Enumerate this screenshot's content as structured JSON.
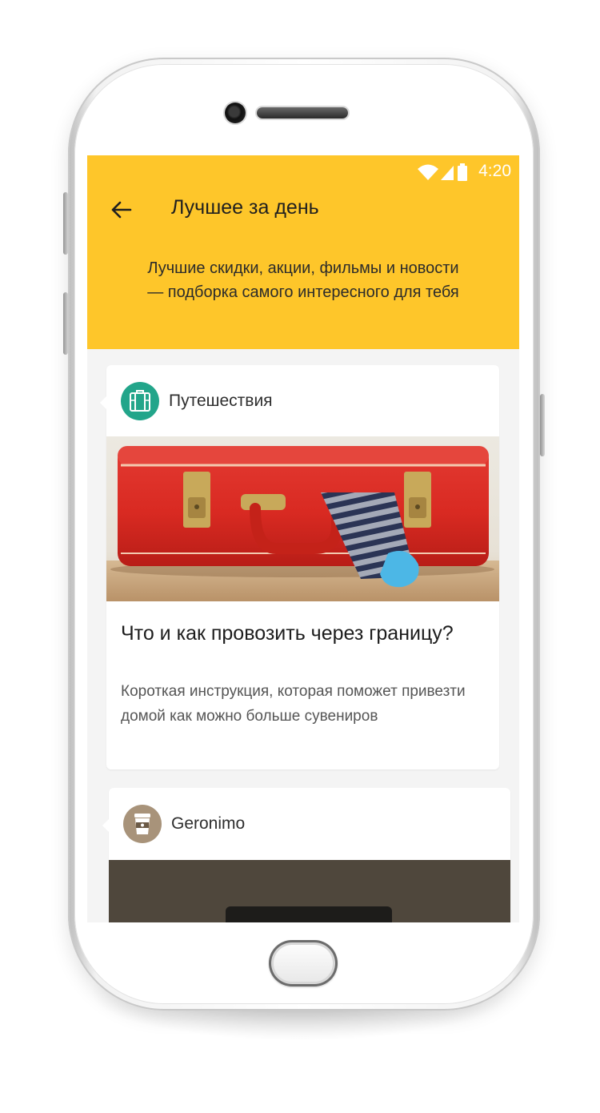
{
  "status_bar": {
    "time": "4:20",
    "icons": [
      "wifi-icon",
      "signal-icon",
      "battery-icon"
    ]
  },
  "header": {
    "title": "Лучшее за день",
    "subtitle": "Лучшие скидки, акции, фильмы и новости — подборка самого интересного для тебя",
    "background": "#fec62a",
    "back_icon": "arrow-left-icon"
  },
  "feed": [
    {
      "source": "Путешествия",
      "source_icon": "suitcase-icon",
      "source_color": "#22a58a",
      "image": "red-suitcase-photo",
      "title": "Что и как провозить через границу?",
      "description": "Короткая инструкция, которая поможет привезти домой как можно больше сувениров"
    },
    {
      "source": "Geronimo",
      "source_icon": "coffee-cup-icon",
      "source_color": "#a8937a",
      "image": "dark-photo"
    }
  ]
}
